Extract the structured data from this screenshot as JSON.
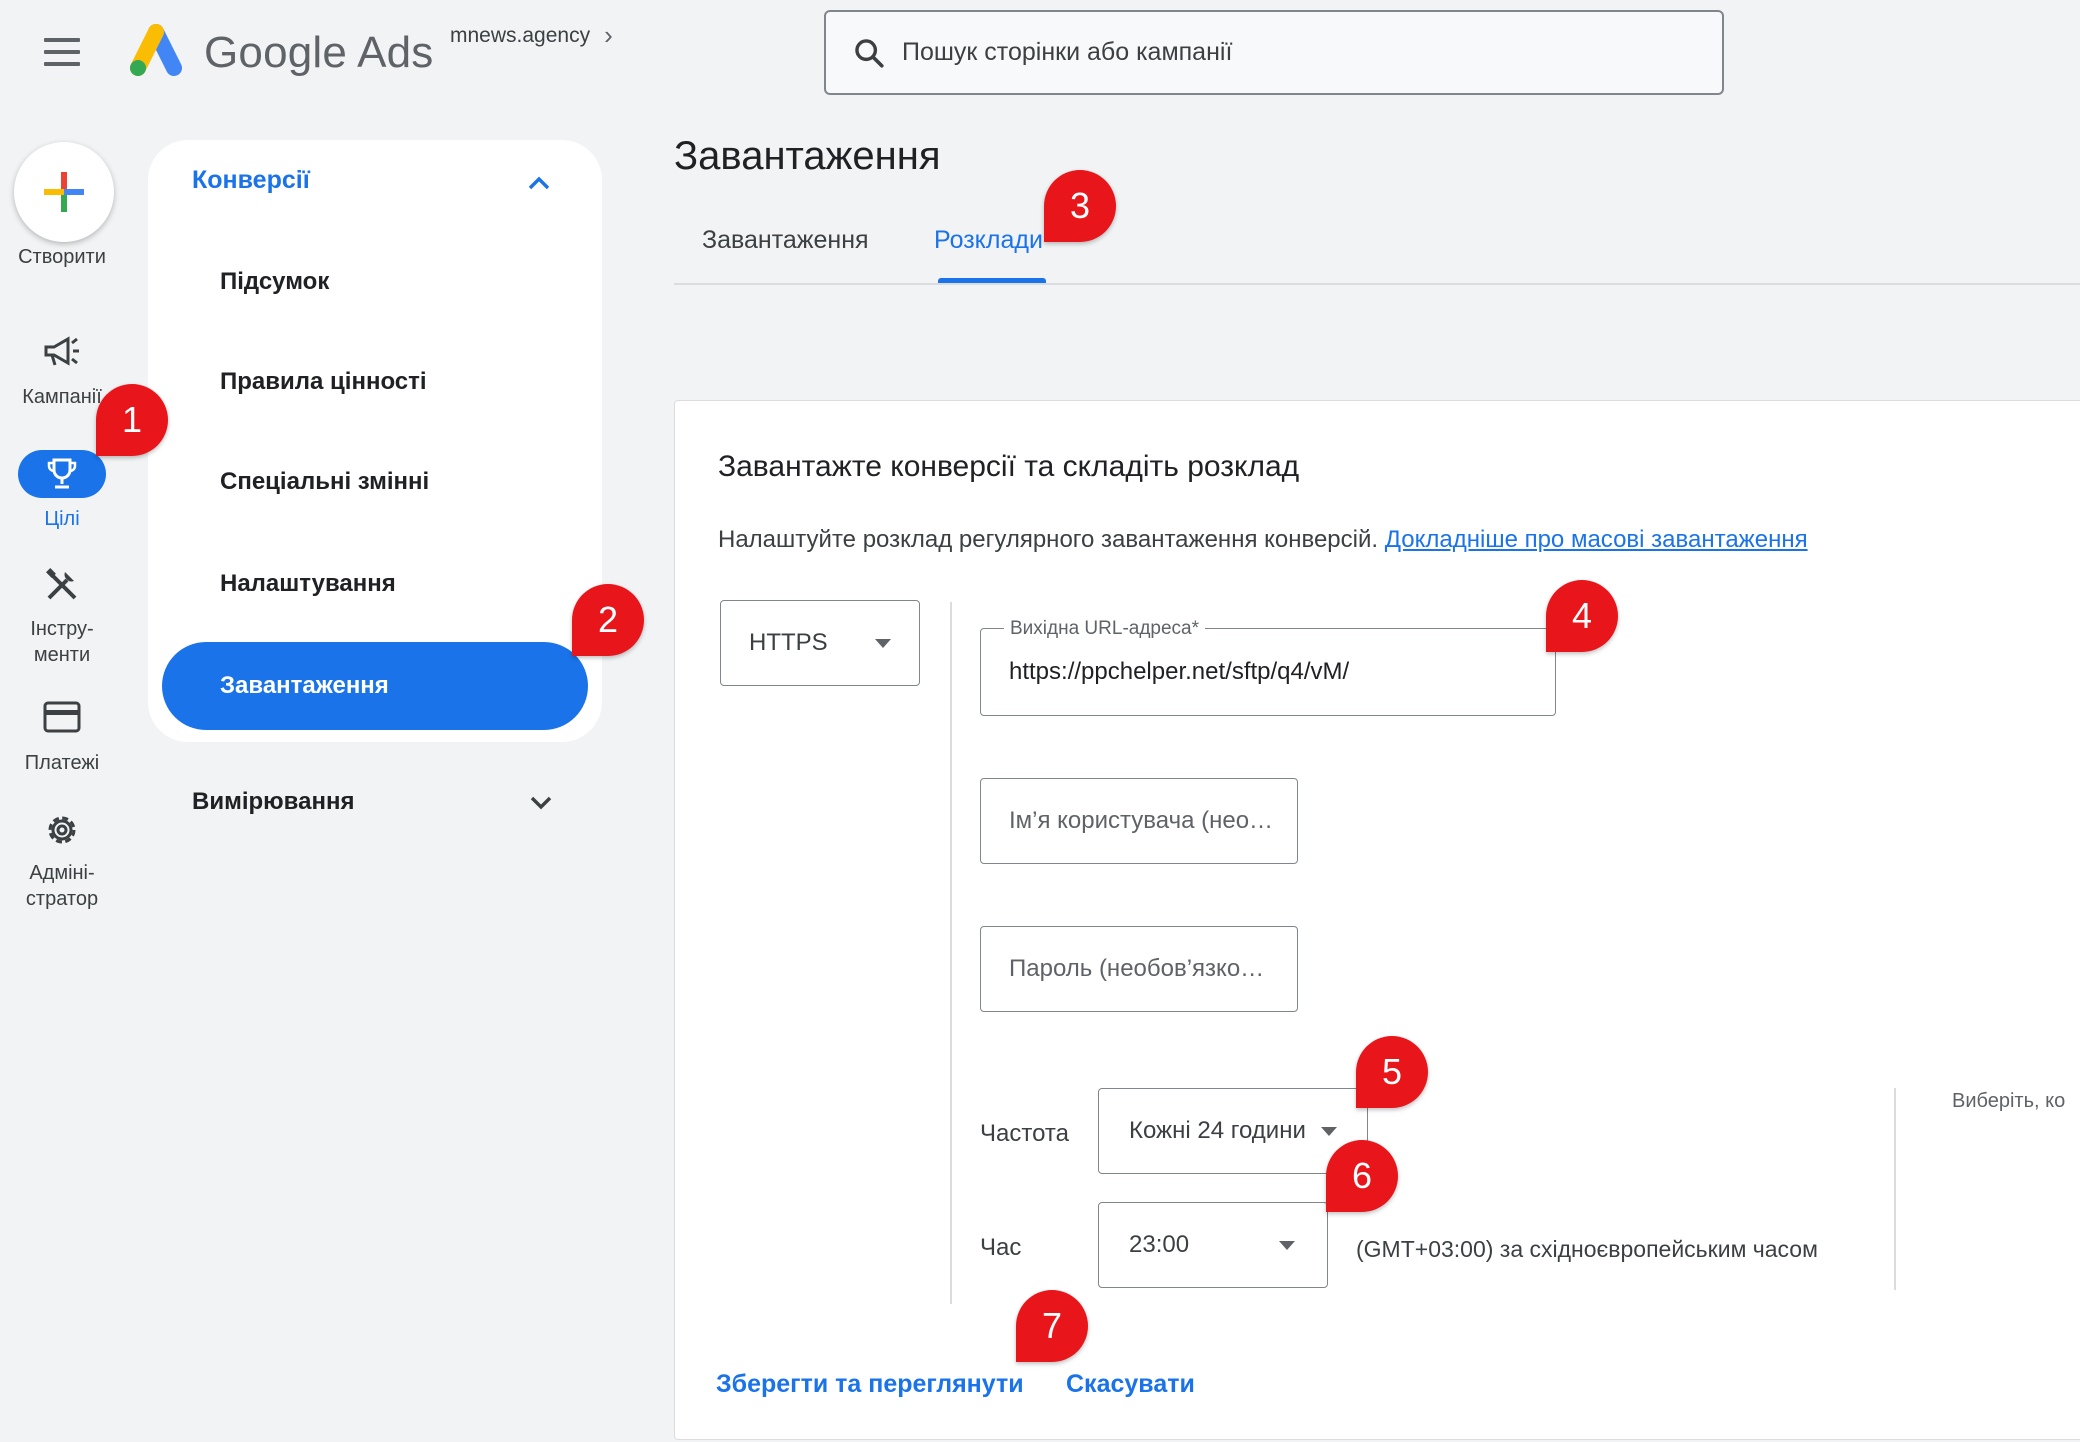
{
  "header": {
    "brand": "Google Ads",
    "account": "mnews.agency",
    "search_placeholder": "Пошук сторінки або кампанії"
  },
  "rail": {
    "create": "Створити",
    "campaigns": "Кампанії",
    "goals": "Цілі",
    "tools_line1": "Інстру-",
    "tools_line2": "менти",
    "billing": "Платежі",
    "admin_line1": "Адміні-",
    "admin_line2": "стратор"
  },
  "nav": {
    "section": "Конверсії",
    "items": [
      "Підсумок",
      "Правила цінності",
      "Спеціальні змінні",
      "Налаштування"
    ],
    "active": "Завантаження",
    "measurement": "Вимірювання"
  },
  "main": {
    "title": "Завантаження",
    "tabs": [
      "Завантаження",
      "Розклади"
    ]
  },
  "form": {
    "title": "Завантажте конверсії та складіть розклад",
    "description": "Налаштуйте розклад регулярного завантаження конверсій.",
    "learn_more": "Докладніше про масові завантаження",
    "protocol": "HTTPS",
    "url_label": "Вихідна URL-адреса*",
    "url_value": "https://ppchelper.net/sftp/q4/vM/",
    "username_placeholder": "Ім’я користувача (нео…",
    "password_placeholder": "Пароль (необов’язко…",
    "frequency_label": "Частота",
    "frequency_value": "Кожні 24 години",
    "time_label": "Час",
    "time_value": "23:00",
    "timezone": "(GMT+03:00) за східноєвропейським часом",
    "choose_hint": "Виберіть, ко",
    "save": "Зберегти та переглянути",
    "cancel": "Скасувати"
  },
  "markers": [
    "1",
    "2",
    "3",
    "4",
    "5",
    "6",
    "7"
  ],
  "colors": {
    "accent": "#1a73e8",
    "marker": "#e8151b",
    "background": "#f1f3f4"
  }
}
